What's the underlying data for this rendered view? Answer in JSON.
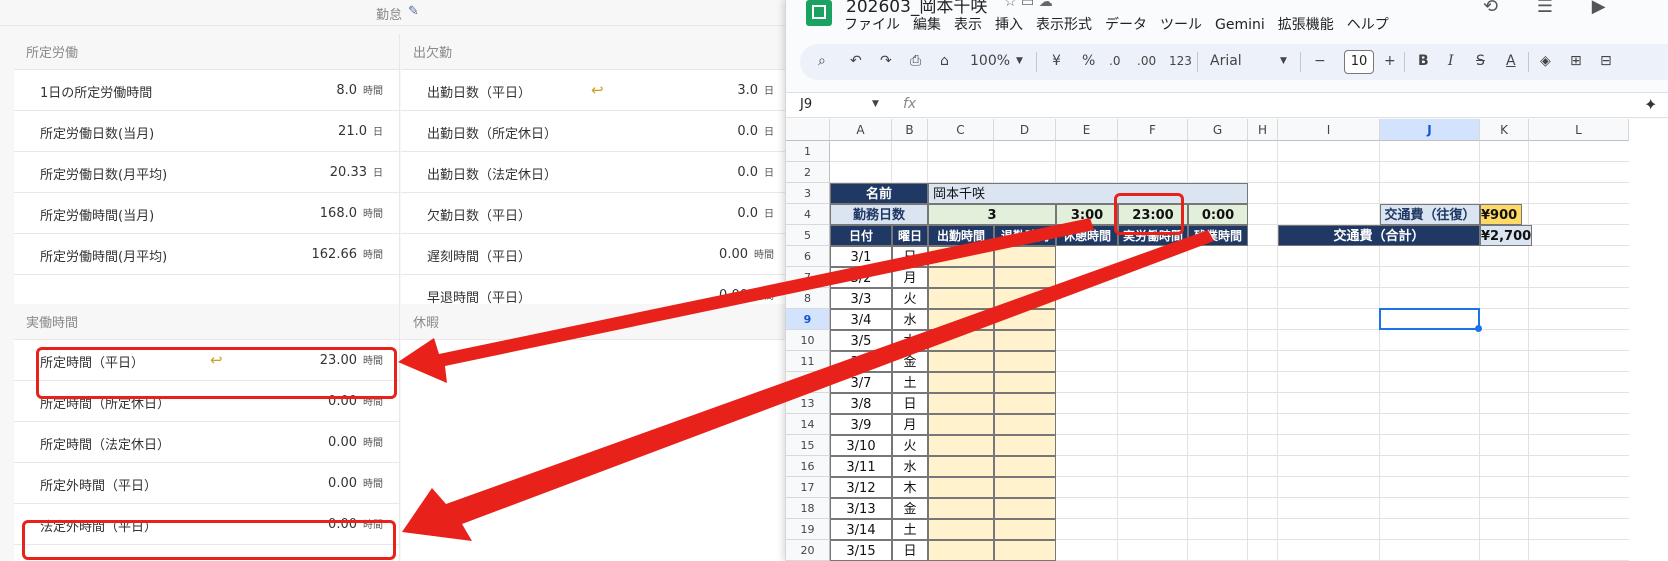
{
  "left_panel": {
    "section_title": "勤怠",
    "pencil_icon": "✎",
    "col1_header": "所定労働",
    "col2_header": "出欠勤",
    "col1_rows": [
      {
        "label": "1日の所定労働時間",
        "value": "8.0",
        "unit": "時間"
      },
      {
        "label": "所定労働日数(当月)",
        "value": "21.0",
        "unit": "日"
      },
      {
        "label": "所定労働日数(月平均)",
        "value": "20.33",
        "unit": "日"
      },
      {
        "label": "所定労働時間(当月)",
        "value": "168.0",
        "unit": "時間"
      },
      {
        "label": "所定労働時間(月平均)",
        "value": "162.66",
        "unit": "時間"
      }
    ],
    "col2_rows": [
      {
        "label": "出勤日数（平日）",
        "value": "3.0",
        "unit": "日"
      },
      {
        "label": "出勤日数（所定休日）",
        "value": "0.0",
        "unit": "日"
      },
      {
        "label": "出勤日数（法定休日）",
        "value": "0.0",
        "unit": "日"
      },
      {
        "label": "欠勤日数（平日）",
        "value": "0.0",
        "unit": "日"
      },
      {
        "label": "遅刻時間（平日）",
        "value": "0.00",
        "unit": "時間"
      },
      {
        "label": "早退時間（平日）",
        "value": "0.00",
        "unit": "時間"
      }
    ],
    "col1_header2": "実働時間",
    "col2_header2": "休暇",
    "col1_rows2": [
      {
        "label": "所定時間（平日）",
        "value": "23.00",
        "unit": "時間"
      },
      {
        "label": "所定時間（所定休日）",
        "value": "0.00",
        "unit": "時間"
      },
      {
        "label": "所定時間（法定休日）",
        "value": "0.00",
        "unit": "時間"
      },
      {
        "label": "所定外時間（平日）",
        "value": "0.00",
        "unit": "時間"
      },
      {
        "label": "法定外時間（平日）",
        "value": "0.00",
        "unit": "時間"
      }
    ],
    "undo_arrow_icon": "↩"
  },
  "sheets": {
    "doc_title": "202603_岡本千咲",
    "menu": [
      "ファイル",
      "編集",
      "表示",
      "挿入",
      "表示形式",
      "データ",
      "ツール",
      "Gemini",
      "拡張機能",
      "ヘルプ"
    ],
    "toolbar": {
      "zoom": "100%",
      "currency": "¥",
      "percent": "%",
      "dec_decrease": ".0",
      "dec_increase": ".00",
      "number_format": "123",
      "font": "Arial",
      "font_size": "10",
      "bold": "B",
      "italic": "I",
      "text_color": "A"
    },
    "name_box": "J9",
    "fx": "fx",
    "columns": [
      "A",
      "B",
      "C",
      "D",
      "E",
      "F",
      "G",
      "H",
      "I",
      "J",
      "K",
      "L"
    ],
    "rows": [
      "1",
      "2",
      "3",
      "4",
      "5",
      "6",
      "7",
      "8",
      "9",
      "10",
      "11",
      "12",
      "13",
      "14",
      "15",
      "16",
      "17",
      "18",
      "19",
      "20"
    ],
    "cells": {
      "name_label": "名前",
      "name_value": "岡本千咲",
      "workdays_label": "勤務日数",
      "workdays_value": "3",
      "break_total": "3:00",
      "actual_total": "23:00",
      "overtime_total": "0:00",
      "hdr_date": "日付",
      "hdr_dow": "曜日",
      "hdr_in": "出勤時間",
      "hdr_out": "退勤時間",
      "hdr_break": "休憩時間",
      "hdr_actual": "実労働時間",
      "hdr_overtime": "残業時間",
      "transport_round_label": "交通費（往復）",
      "transport_round_value": "¥900",
      "transport_total_label": "交通費（合計）",
      "transport_total_value": "¥2,700"
    },
    "dates": [
      {
        "date": "3/1",
        "dow": "日"
      },
      {
        "date": "3/2",
        "dow": "月"
      },
      {
        "date": "3/3",
        "dow": "火"
      },
      {
        "date": "3/4",
        "dow": "水"
      },
      {
        "date": "3/5",
        "dow": "木"
      },
      {
        "date": "3/6",
        "dow": "金"
      },
      {
        "date": "3/7",
        "dow": "土"
      },
      {
        "date": "3/8",
        "dow": "日"
      },
      {
        "date": "3/9",
        "dow": "月"
      },
      {
        "date": "3/10",
        "dow": "火"
      },
      {
        "date": "3/11",
        "dow": "水"
      },
      {
        "date": "3/12",
        "dow": "木"
      },
      {
        "date": "3/13",
        "dow": "金"
      },
      {
        "date": "3/14",
        "dow": "土"
      },
      {
        "date": "3/15",
        "dow": "日"
      }
    ]
  },
  "colors": {
    "annotation_red": "#e8211b",
    "navy": "#1f3864",
    "sheets_green": "#1aa260",
    "selection_blue": "#1a73e8"
  }
}
